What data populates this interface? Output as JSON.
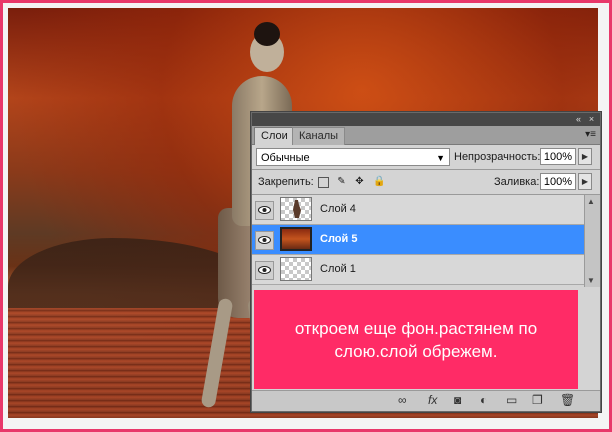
{
  "panel": {
    "tabs": [
      {
        "label": "Слои",
        "active": true
      },
      {
        "label": "Каналы",
        "active": false
      }
    ],
    "titlebar": {
      "collapse_glyph": "«",
      "close_glyph": "×"
    },
    "blend_mode": "Обычные",
    "opacity_label": "Непрозрачность:",
    "opacity_value": "100%",
    "lock_label": "Закрепить:",
    "fill_label": "Заливка:",
    "fill_value": "100%",
    "layers": [
      {
        "name": "Слой 4",
        "thumb": "figure",
        "visible": true,
        "selected": false
      },
      {
        "name": "Слой 5",
        "thumb": "autumn",
        "visible": true,
        "selected": true
      },
      {
        "name": "Слой 1",
        "thumb": "transparent",
        "visible": true,
        "selected": false
      }
    ]
  },
  "caption": {
    "text": "откроем еще фон.растянем по слою.слой обрежем."
  },
  "colors": {
    "frame_border": "#e8386a",
    "caption_bg": "#ff2b66",
    "selected_layer": "#3a8dff"
  }
}
